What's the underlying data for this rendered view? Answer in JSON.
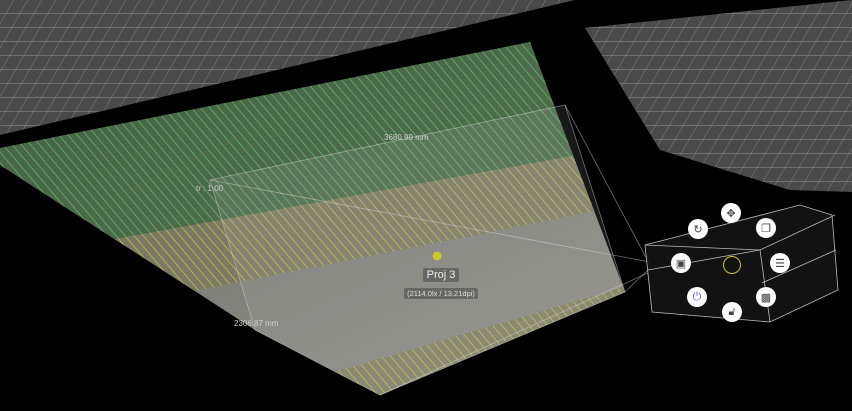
{
  "scene": {
    "width_label": "3680.99 mm",
    "height_label": "2306.87 mm",
    "throw_ratio_label": "tr : 1.00",
    "projector": {
      "name": "Proj 3",
      "info": "(2114.0lx / 13.21dpi)"
    },
    "colors": {
      "green_zone": "#3fcf3f",
      "yellow_zone": "#d8d84a",
      "ring": "#c8c82a",
      "power_icon": "#5b4de0"
    }
  },
  "radial_menu": [
    {
      "name": "move",
      "icon": "move-icon"
    },
    {
      "name": "rotate",
      "icon": "rotate-icon"
    },
    {
      "name": "duplicate",
      "icon": "copy-icon"
    },
    {
      "name": "properties",
      "icon": "portrait-icon"
    },
    {
      "name": "settings",
      "icon": "sliders-icon"
    },
    {
      "name": "power",
      "icon": "power-icon"
    },
    {
      "name": "content",
      "icon": "image-icon"
    },
    {
      "name": "lock",
      "icon": "lock-icon"
    }
  ]
}
